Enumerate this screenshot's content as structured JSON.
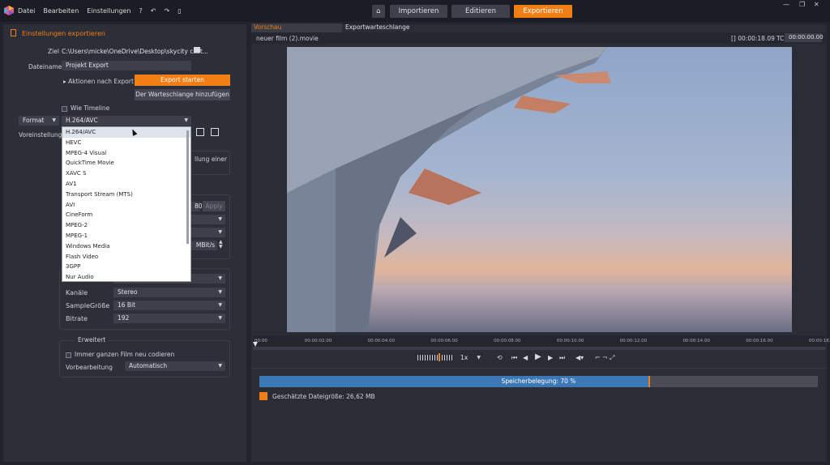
{
  "menu": {
    "items": [
      "Datei",
      "Bearbeiten",
      "Einstellungen"
    ],
    "help": "?",
    "undo": "↶",
    "redo": "↷",
    "doc": "▯"
  },
  "top_tabs": {
    "home": "⌂",
    "import": "Importieren",
    "edit": "Editieren",
    "export": "Exportieren"
  },
  "window": {
    "minimize": "—",
    "maximize": "❐",
    "close": "✕"
  },
  "left": {
    "title": "Einstellungen exportieren",
    "ziel_label": "Ziel",
    "ziel_value": "C:\\Users\\micke\\OneDrive\\Desktop\\skycity cast...",
    "dateiname_label": "Dateiname",
    "dateiname_value": "Projekt Export",
    "aktionen": "Aktionen nach Export",
    "export_start": "Export starten",
    "queue_add": "Der Warteschlange hinzufügen",
    "wie_timeline": "Wie Timeline",
    "format_label": "Format",
    "format_value": "H.264/AVC",
    "voreinstellung_label": "Voreinstellung",
    "partial_text1": "llung einer",
    "partial_text2": "Apply",
    "partial_num": "80",
    "partial_unit": "MBit/s",
    "formats": [
      "H.264/AVC",
      "HEVC",
      "MPEG-4 Visual",
      "QuickTime Movie",
      "XAVC S",
      "AV1",
      "Transport Stream (MTS)",
      "AVI",
      "CineForm",
      "MPEG-2",
      "MPEG-1",
      "Windows Media",
      "Flash Video",
      "3GPP",
      "Nur Audio"
    ],
    "kanaele_label": "Kanäle",
    "kanaele_value": "Stereo",
    "sample_label": "SampleGröße",
    "sample_value": "16 Bit",
    "bitrate_label": "Bitrate",
    "bitrate_value": "192",
    "erweitert": "Erweitert",
    "recode": "Immer ganzen Film neu codieren",
    "vorbereitung_label": "Vorbearbeitung",
    "vorbereitung_value": "Automatisch"
  },
  "right": {
    "tab_preview": "Vorschau",
    "tab_queue": "Exportwarteschlange",
    "file": "neuer film (2).movie",
    "duration": "00:00:18.09",
    "tc_label": "TC",
    "tc_value": "00:00:00.00",
    "speed": "1x",
    "ticks": [
      "00:00",
      "00:00:02.00",
      "00:00:04.00",
      "00:00:06.00",
      "00:00:08.00",
      "00:00:10.00",
      "00:00:12.00",
      "00:00:14.00",
      "00:00:16.00",
      "00:00:18.00"
    ],
    "storage_label": "Speicherbelegung: 70 %",
    "storage_fill": 0.7,
    "filesize": "Geschätzte Dateigröße: 26,62 MB"
  },
  "colors": {
    "accent": "#f27e16",
    "progress": "#3d78b6"
  }
}
